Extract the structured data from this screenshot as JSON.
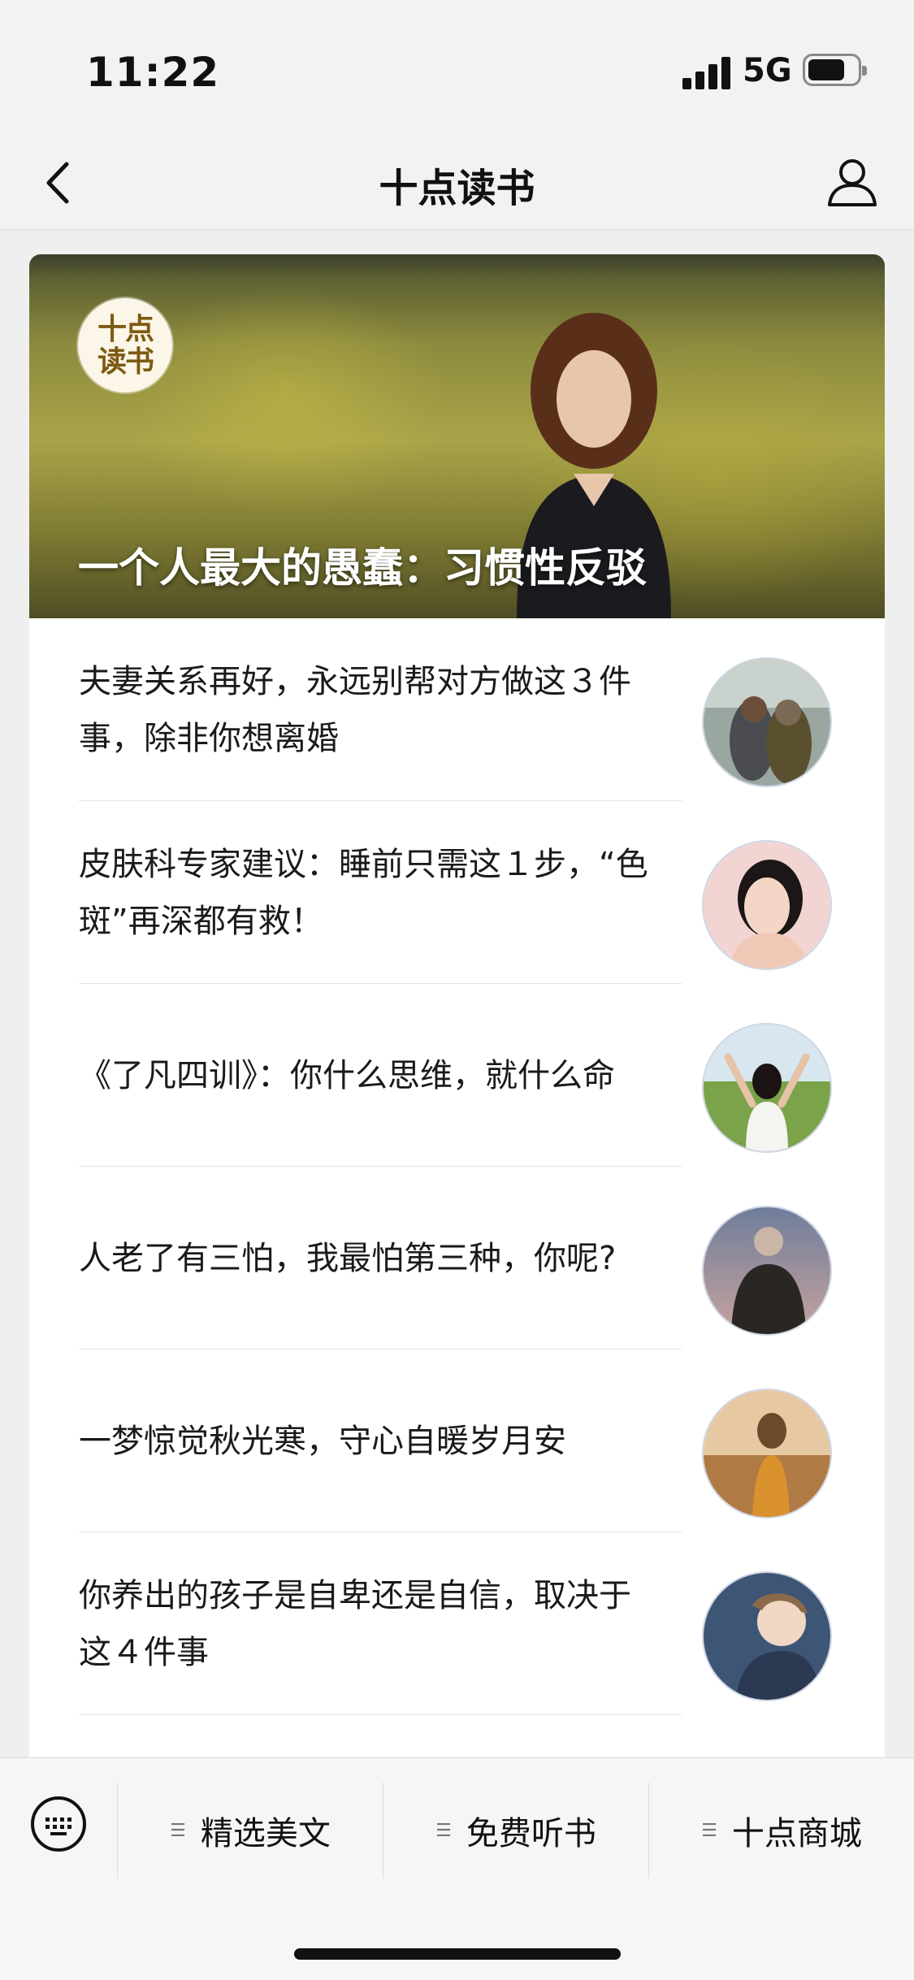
{
  "status_bar": {
    "time": "11:22",
    "network": "5G"
  },
  "nav": {
    "title": "十点读书"
  },
  "hero": {
    "logo_text": "十点读书",
    "title": "一个人最大的愚蠢：习惯性反驳"
  },
  "articles": [
    {
      "title": "夫妻关系再好，永远别帮对方做这３件事，除非你想离婚",
      "thumb": "couple-photo"
    },
    {
      "title": "皮肤科专家建议：睡前只需这１步，“色斑”再深都有救！",
      "thumb": "woman-portrait"
    },
    {
      "title": "《了凡四训》：你什么思维，就什么命",
      "thumb": "woman-field"
    },
    {
      "title": "人老了有三怕，我最怕第三种，你呢?",
      "thumb": "elderly-man"
    },
    {
      "title": "一梦惊觉秋光寒，守心自暖岁月安",
      "thumb": "woman-autumn"
    },
    {
      "title": "你养出的孩子是自卑还是自信，取决于这４件事",
      "thumb": "child-photo"
    }
  ],
  "menu": {
    "items": [
      "精选美文",
      "免费听书",
      "十点商城"
    ]
  }
}
